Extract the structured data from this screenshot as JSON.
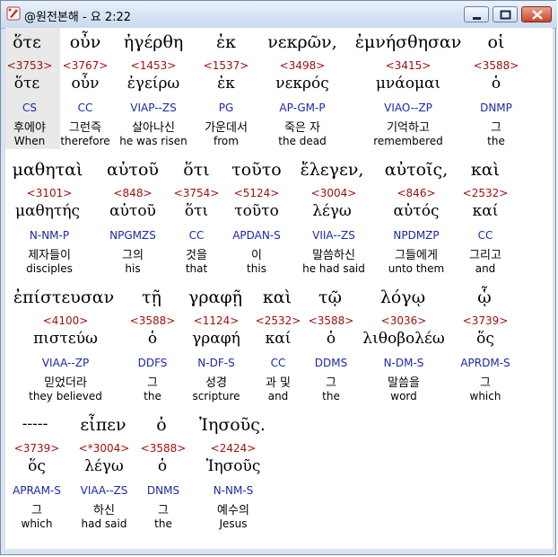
{
  "window": {
    "title": "@원전본해 - 요 2:22"
  },
  "icons": {
    "app": "app-logo-icon",
    "minimize": "minimize-icon",
    "maximize": "maximize-icon",
    "close": "close-icon"
  },
  "colors": {
    "strongs": "#a01010",
    "parsing": "#1a2aa8",
    "text": "#000000"
  },
  "rows": [
    {
      "words": [
        {
          "greek": "ὅτε",
          "strongs": "<3753>",
          "lexeme": "ὅτε",
          "parsing": "CS",
          "korean": "후에야",
          "english": "When"
        },
        {
          "greek": "οὖν",
          "strongs": "<3767>",
          "lexeme": "οὖν",
          "parsing": "CC",
          "korean": "그런즉",
          "english": "therefore"
        },
        {
          "greek": "ἠγέρθη",
          "strongs": "<1453>",
          "lexeme": "ἐγείρω",
          "parsing": "VIAP--ZS",
          "korean": "살아나신",
          "english": "he was risen"
        },
        {
          "greek": "ἐκ",
          "strongs": "<1537>",
          "lexeme": "ἐκ",
          "parsing": "PG",
          "korean": "가운데서",
          "english": "from"
        },
        {
          "greek": "νεκρῶν,",
          "strongs": "<3498>",
          "lexeme": "νεκρός",
          "parsing": "AP-GM-P",
          "korean": "죽은 자",
          "english": "the dead"
        },
        {
          "greek": "ἐμνήσθησαν",
          "strongs": "<3415>",
          "lexeme": "μνάομαι",
          "parsing": "VIAO--ZP",
          "korean": "기억하고",
          "english": "remembered"
        },
        {
          "greek": "οἱ",
          "strongs": "<3588>",
          "lexeme": "ὁ",
          "parsing": "DNMP",
          "korean": "그",
          "english": "the"
        }
      ]
    },
    {
      "words": [
        {
          "greek": "μαθηταὶ",
          "strongs": "<3101>",
          "lexeme": "μαθητής",
          "parsing": "N-NM-P",
          "korean": "제자들이",
          "english": "disciples"
        },
        {
          "greek": "αὐτοῦ",
          "strongs": "<848>",
          "lexeme": "αὐτοῦ",
          "parsing": "NPGMZS",
          "korean": "그의",
          "english": "his"
        },
        {
          "greek": "ὅτι",
          "strongs": "<3754>",
          "lexeme": "ὅτι",
          "parsing": "CC",
          "korean": "것을",
          "english": "that"
        },
        {
          "greek": "τοῦτο",
          "strongs": "<5124>",
          "lexeme": "τοῦτο",
          "parsing": "APDAN-S",
          "korean": "이",
          "english": "this"
        },
        {
          "greek": "ἔλεγεν,",
          "strongs": "<3004>",
          "lexeme": "λέγω",
          "parsing": "VIIA--ZS",
          "korean": "말씀하신",
          "english": "he had said"
        },
        {
          "greek": "αὐτοῖς,",
          "strongs": "<846>",
          "lexeme": "αὐτός",
          "parsing": "NPDMZP",
          "korean": "그들에게",
          "english": "unto them"
        },
        {
          "greek": "καὶ",
          "strongs": "<2532>",
          "lexeme": "καί",
          "parsing": "CC",
          "korean": "그리고",
          "english": "and"
        }
      ]
    },
    {
      "words": [
        {
          "greek": "ἐπίστευσαν",
          "strongs": "<4100>",
          "lexeme": "πιστεύω",
          "parsing": "VIAA--ZP",
          "korean": "믿었더라",
          "english": "they believed"
        },
        {
          "greek": "τῇ",
          "strongs": "<3588>",
          "lexeme": "ὁ",
          "parsing": "DDFS",
          "korean": "그",
          "english": "the"
        },
        {
          "greek": "γραφῇ",
          "strongs": "<1124>",
          "lexeme": "γραφή",
          "parsing": "N-DF-S",
          "korean": "성경",
          "english": "scripture"
        },
        {
          "greek": "καὶ",
          "strongs": "<2532>",
          "lexeme": "καί",
          "parsing": "CC",
          "korean": "과 및",
          "english": "and"
        },
        {
          "greek": "τῷ",
          "strongs": "<3588>",
          "lexeme": "ὁ",
          "parsing": "DDMS",
          "korean": "그",
          "english": "the"
        },
        {
          "greek": "λόγῳ",
          "strongs": "<3036>",
          "lexeme": "λιθοβολέω",
          "parsing": "N-DM-S",
          "korean": "말씀을",
          "english": "word"
        },
        {
          "greek": "ᾧ",
          "strongs": "<3739>",
          "lexeme": "ὅς",
          "parsing": "APRDM-S",
          "korean": "그",
          "english": "which"
        }
      ]
    },
    {
      "words": [
        {
          "greek": "-----",
          "strongs": "<3739>",
          "lexeme": "ὅς",
          "parsing": "APRAM-S",
          "korean": "그",
          "english": "which"
        },
        {
          "greek": "εἶπεν",
          "strongs": "<*3004>",
          "lexeme": "λέγω",
          "parsing": "VIAA--ZS",
          "korean": "하신",
          "english": "had said"
        },
        {
          "greek": "ὁ",
          "strongs": "<3588>",
          "lexeme": "ὁ",
          "parsing": "DNMS",
          "korean": "그",
          "english": "the"
        },
        {
          "greek": "Ἰησοῦς.",
          "strongs": "<2424>",
          "lexeme": "Ἰησοῦς",
          "parsing": "N-NM-S",
          "korean": "예수의",
          "english": "Jesus"
        }
      ]
    }
  ]
}
